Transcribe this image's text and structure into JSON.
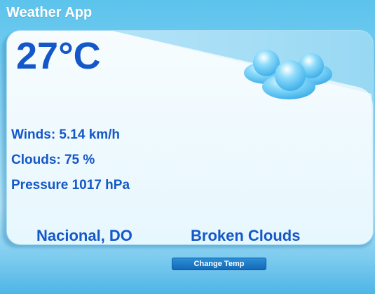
{
  "app": {
    "title": "Weather App"
  },
  "weather": {
    "temperature": "27°C",
    "winds": "Winds: 5.14 km/h",
    "clouds": "Clouds: 75 %",
    "pressure": "Pressure 1017 hPa",
    "location": "Nacional, DO",
    "condition": "Broken Clouds",
    "icon": "clouds-icon"
  },
  "actions": {
    "change_temp_label": "Change Temp"
  },
  "colors": {
    "accent_text": "#1457c8",
    "card_background": "#d7f1fc",
    "button": "#1569b8"
  }
}
